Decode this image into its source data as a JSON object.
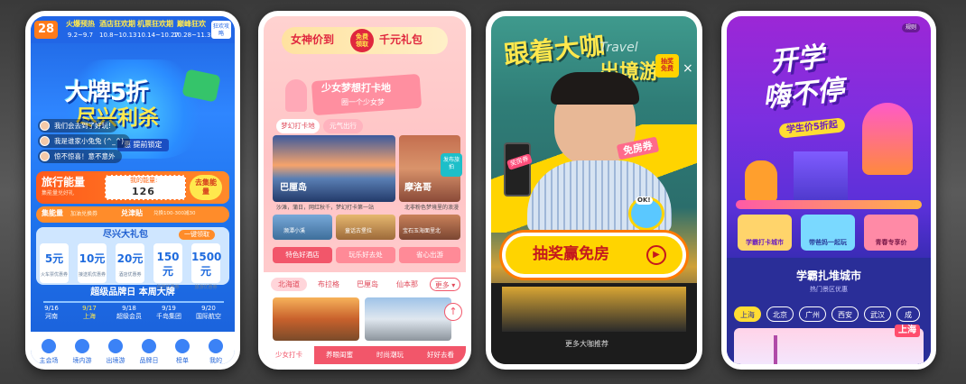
{
  "card1": {
    "logo": "28",
    "timeline": [
      {
        "label": "火爆预热",
        "date": "9.2~9.7"
      },
      {
        "label": "酒店狂欢期",
        "date": "10.8~10.13"
      },
      {
        "label": "机票狂欢期",
        "date": "10.14~10.27"
      },
      {
        "label": "巅峰狂欢",
        "date": "10.28~11.3"
      }
    ],
    "rule_button": "狂欢攻略",
    "hero_line1": "大牌5折",
    "hero_line2": "尽兴利杀",
    "hero_ribbon": "惠 提前锁定",
    "danmu": [
      "我们会去到了好玩!",
      "我是谁家小兔兔 (^_^)",
      "惊不惊喜！意不意外"
    ],
    "energy_title": "旅行能量",
    "energy_sub": "集能量兑好礼",
    "energy_value_label": "我的能量:",
    "energy_value": "126",
    "go_collect": "去集能量",
    "exchange_label": "集能量",
    "exchange_sub": "加油兑换券",
    "exchange_btn": "兑津贴",
    "exchange_note": "兑换100-300减30",
    "gift_title": "尽兴大礼包",
    "gift_button": "一键领取",
    "coupons": [
      {
        "value": "5元",
        "name": "火车票优惠券"
      },
      {
        "value": "10元",
        "name": "接送机优惠券"
      },
      {
        "value": "20元",
        "name": "酒店优惠券"
      },
      {
        "value": "150元",
        "name": "跨境优惠券"
      },
      {
        "value": "1500元",
        "name": "旅游优惠券"
      }
    ],
    "super_day": "超级品牌日 本周大牌",
    "dates": [
      {
        "date": "9/16",
        "name": "河南"
      },
      {
        "date": "9/17",
        "name": "上海"
      },
      {
        "date": "9/18",
        "name": "超级会员"
      },
      {
        "date": "9/19",
        "name": "千岛集团"
      },
      {
        "date": "9/20",
        "name": "国际航空"
      }
    ],
    "nav": [
      "主会场",
      "境内游",
      "出境游",
      "品牌日",
      "榜单",
      "我的"
    ]
  },
  "card2": {
    "header": "女神价到",
    "header_badge": "免费领取",
    "header_right": "千元礼包",
    "banner_title": "少女梦想打卡地",
    "banner_sub": "圈一个少女梦",
    "tabs": [
      "梦幻打卡地",
      "元气出行"
    ],
    "city1": "巴厘岛",
    "city1_desc": "沙滩，蒲日，网红秋千，梦幻打卡第一站",
    "city2": "摩洛哥",
    "city2_desc": "北非粉色梦境里的浪漫",
    "publish": "发布旅拍",
    "small_photos": [
      "濒潭小溪",
      "童话古堡拉",
      "宝石玉海面里北"
    ],
    "cat_tabs": [
      "特色好酒店",
      "玩乐好去处",
      "省心出游"
    ],
    "chips": [
      "北海道",
      "布拉格",
      "巴厘岛",
      "仙本那",
      "更多"
    ],
    "bottom_tabs": [
      "少女打卡",
      "养眼闺蜜",
      "时尚潮玩",
      "好好去看"
    ]
  },
  "card3": {
    "headline_left": "跟着大咖",
    "headline_right": "出境游",
    "travel_word": "Travel",
    "stamp": "抽奖 免费",
    "coupon1": "奖房券",
    "coupon2": "免房券",
    "bubble": "OK!",
    "lottery_button": "抽奖赢免房",
    "more": "更多大咖推荐",
    "close_icon": "×"
  },
  "card4": {
    "rule": "规则",
    "title_line1": "开学",
    "title_line2": "嗨不停",
    "badge": "学生价5折起",
    "features": [
      "学霸打卡城市",
      "带爸妈一起玩",
      "青春专享价"
    ],
    "section_title": "学霸扎堆城市",
    "section_sub": "热门景区优惠",
    "cities": [
      "上海",
      "北京",
      "广州",
      "西安",
      "武汉",
      "成"
    ],
    "city_card": "上海"
  },
  "colors": {
    "c1_blue": "#1f74ee",
    "c1_orange": "#ff6a1a",
    "c2_pink": "#f2566a",
    "c3_yellow": "#ffd400",
    "c4_purple": "#7b2fe0"
  }
}
